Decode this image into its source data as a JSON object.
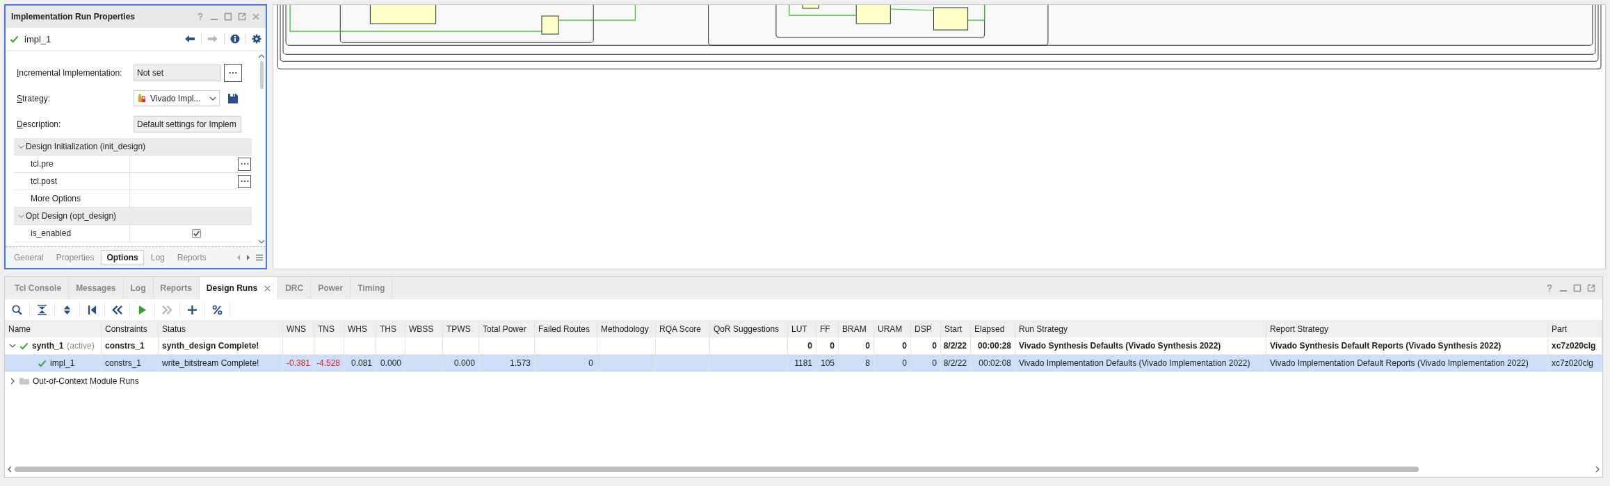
{
  "properties": {
    "title": "Implementation Run Properties",
    "run": {
      "name": "impl_1",
      "complete": true
    },
    "fields": [
      {
        "label": "Incremental Implementation:",
        "kind": "browse",
        "value": "Not set"
      },
      {
        "label": "Strategy:",
        "kind": "dropdown",
        "value": "Vivado Impl..."
      },
      {
        "label": "Description:",
        "kind": "text",
        "value": "Default settings for Implem"
      }
    ],
    "sections": [
      {
        "title": "Design Initialization (init_design)",
        "expanded": true,
        "rows": [
          {
            "name": "tcl.pre",
            "kind": "file"
          },
          {
            "name": "tcl.post",
            "kind": "file"
          },
          {
            "name": "More Options",
            "kind": "plain"
          }
        ]
      },
      {
        "title": "Opt Design (opt_design)",
        "expanded": true,
        "rows": [
          {
            "name": "is_enabled",
            "kind": "checkbox",
            "checked": true
          }
        ]
      }
    ],
    "tabs": [
      {
        "label": "General",
        "selected": false
      },
      {
        "label": "Properties",
        "selected": false
      },
      {
        "label": "Options",
        "selected": true
      },
      {
        "label": "Log",
        "selected": false
      },
      {
        "label": "Reports",
        "selected": false
      }
    ]
  },
  "bottom": {
    "tabs": [
      {
        "label": "Tcl Console",
        "selected": false,
        "closable": false
      },
      {
        "label": "Messages",
        "selected": false,
        "closable": false
      },
      {
        "label": "Log",
        "selected": false,
        "closable": false
      },
      {
        "label": "Reports",
        "selected": false,
        "closable": false
      },
      {
        "label": "Design Runs",
        "selected": true,
        "closable": true
      },
      {
        "label": "DRC",
        "selected": false,
        "closable": false
      },
      {
        "label": "Power",
        "selected": false,
        "closable": false
      },
      {
        "label": "Timing",
        "selected": false,
        "closable": false
      }
    ],
    "toolbar": [
      {
        "kind": "search",
        "disabled": false
      },
      {
        "kind": "collapse",
        "disabled": false
      },
      {
        "kind": "expand",
        "disabled": false
      },
      {
        "kind": "first",
        "disabled": false
      },
      {
        "kind": "previous",
        "disabled": false
      },
      {
        "kind": "run",
        "disabled": false
      },
      {
        "kind": "next",
        "disabled": true
      },
      {
        "kind": "add",
        "disabled": false
      },
      {
        "kind": "percent",
        "disabled": false
      }
    ],
    "table": {
      "columns": [
        {
          "label": "Name",
          "kind": "text"
        },
        {
          "label": "Constraints",
          "kind": "text"
        },
        {
          "label": "Status",
          "kind": "text"
        },
        {
          "label": "WNS",
          "kind": "number"
        },
        {
          "label": "TNS",
          "kind": "number"
        },
        {
          "label": "WHS",
          "kind": "number"
        },
        {
          "label": "THS",
          "kind": "number"
        },
        {
          "label": "WBSS",
          "kind": "number"
        },
        {
          "label": "TPWS",
          "kind": "number"
        },
        {
          "label": "Total Power",
          "kind": "number"
        },
        {
          "label": "Failed Routes",
          "kind": "number"
        },
        {
          "label": "Methodology",
          "kind": "text"
        },
        {
          "label": "RQA Score",
          "kind": "number"
        },
        {
          "label": "QoR Suggestions",
          "kind": "text"
        },
        {
          "label": "LUT",
          "kind": "number"
        },
        {
          "label": "FF",
          "kind": "number"
        },
        {
          "label": "BRAM",
          "kind": "number"
        },
        {
          "label": "URAM",
          "kind": "number"
        },
        {
          "label": "DSP",
          "kind": "number"
        },
        {
          "label": "Start",
          "kind": "number"
        },
        {
          "label": "Elapsed",
          "kind": "number"
        },
        {
          "label": "Run Strategy",
          "kind": "text"
        },
        {
          "label": "Report Strategy",
          "kind": "text"
        },
        {
          "label": "Part",
          "kind": "text"
        }
      ],
      "rows": [
        {
          "kind": "run",
          "name": "synth_1",
          "tag": "(active)",
          "complete": true,
          "bold": true,
          "selected": false,
          "expanded": true,
          "cells": [
            "constrs_1",
            "synth_design Complete!",
            null,
            null,
            null,
            null,
            null,
            null,
            null,
            null,
            null,
            null,
            null,
            "0",
            "0",
            "0",
            "0",
            "0",
            "8/2/22",
            "00:00:28",
            "Vivado Synthesis Defaults (Vivado Synthesis 2022)",
            "Vivado Synthesis Default Reports (Vivado Synthesis 2022)",
            "xc7z020clg"
          ],
          "children": [
            {
              "kind": "run",
              "name": "impl_1",
              "complete": true,
              "bold": false,
              "selected": true,
              "negative_slack": true,
              "cells": [
                "constrs_1",
                "write_bitstream Complete!",
                "-0.381",
                "-4.528",
                "0.081",
                "0.000",
                null,
                "0.000",
                "1.573",
                "0",
                null,
                null,
                null,
                "1181",
                "105",
                "8",
                "0",
                "0",
                "8/2/22",
                "00:02:08",
                "Vivado Implementation Defaults (Vivado Implementation 2022)",
                "Vivado Implementation Default Reports (Vivado Implementation 2022)",
                "xc7z020clg"
              ]
            }
          ]
        },
        {
          "kind": "folder",
          "name": "Out-of-Context Module Runs",
          "selected": false,
          "expanded": false
        }
      ]
    }
  }
}
